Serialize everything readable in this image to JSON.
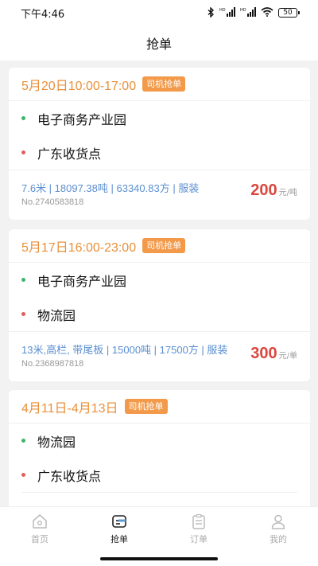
{
  "status_bar": {
    "time": "下午4:46",
    "icons": [
      "bluetooth-icon",
      "hd-signal-icon",
      "hd-signal-icon",
      "wifi-icon"
    ],
    "hd_label": "HD",
    "battery": "50"
  },
  "nav": {
    "title": "抢单"
  },
  "orders": [
    {
      "date": "5月20日10:00-17:00",
      "tag": "司机抢单",
      "from": "电子商务产业园",
      "to": "广东收货点",
      "spec": "7.6米 | 18097.38吨 | 63340.83方 | 服装",
      "no": "No.2740583818",
      "price": "200",
      "unit": "元/吨"
    },
    {
      "date": "5月17日16:00-23:00",
      "tag": "司机抢单",
      "from": "电子商务产业园",
      "to": "物流园",
      "spec": "13米,高栏, 带尾板 | 15000吨 | 17500方 | 服装",
      "no": "No.2368987818",
      "price": "300",
      "unit": "元/单"
    },
    {
      "date": "4月11日-4月13日",
      "tag": "司机抢单",
      "from": "物流园",
      "to": "广东收货点"
    }
  ],
  "tabs": [
    {
      "label": "首页",
      "icon": "home-icon",
      "active": false
    },
    {
      "label": "抢单",
      "icon": "grab-order-icon",
      "active": true
    },
    {
      "label": "订单",
      "icon": "clipboard-icon",
      "active": false
    },
    {
      "label": "我的",
      "icon": "user-icon",
      "active": false
    }
  ],
  "colors": {
    "accent_orange": "#e8903a",
    "tag_orange": "#f29a4a",
    "price_red": "#d9473f",
    "spec_blue": "#5b8fd0",
    "origin_green": "#3bb56a",
    "dest_red": "#e45d5d"
  }
}
